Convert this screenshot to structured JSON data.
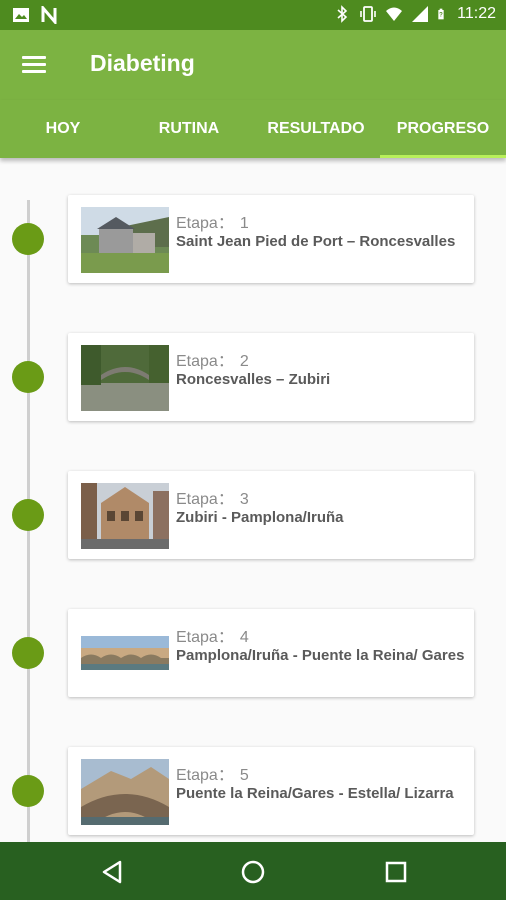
{
  "status_bar": {
    "time": "11:22",
    "left_icons": [
      "image-icon",
      "n-app-icon"
    ],
    "right_icons": [
      "bluetooth-icon",
      "vibrate-icon",
      "wifi-icon",
      "signal-icon",
      "battery-icon"
    ]
  },
  "app_bar": {
    "title": "Diabeting",
    "menu_icon": "hamburger-icon"
  },
  "tabs": [
    {
      "label": "HOY"
    },
    {
      "label": "RUTINA"
    },
    {
      "label": "RESULTADO"
    },
    {
      "label": "PROGRESO",
      "active": true
    }
  ],
  "stages": [
    {
      "label": "Etapa：",
      "number": "1",
      "title": "Saint Jean Pied de Port – Roncesvalles"
    },
    {
      "label": "Etapa：",
      "number": "2",
      "title": "Roncesvalles – Zubiri"
    },
    {
      "label": "Etapa：",
      "number": "3",
      "title": "Zubiri - Pamplona/Iruña"
    },
    {
      "label": "Etapa：",
      "number": "4",
      "title": "Pamplona/Iruña - Puente la Reina/ Gares"
    },
    {
      "label": "Etapa：",
      "number": "5",
      "title": "Puente la Reina/Gares - Estella/ Lizarra"
    }
  ],
  "nav_bar": {
    "icons": [
      "back-icon",
      "home-icon",
      "recents-icon"
    ]
  },
  "colors": {
    "status_bar": "#4e8b1f",
    "app_bar": "#7cb342",
    "tab_indicator": "#b8f05a",
    "timeline_dot": "#6a9b16",
    "nav_bar": "#286020"
  }
}
